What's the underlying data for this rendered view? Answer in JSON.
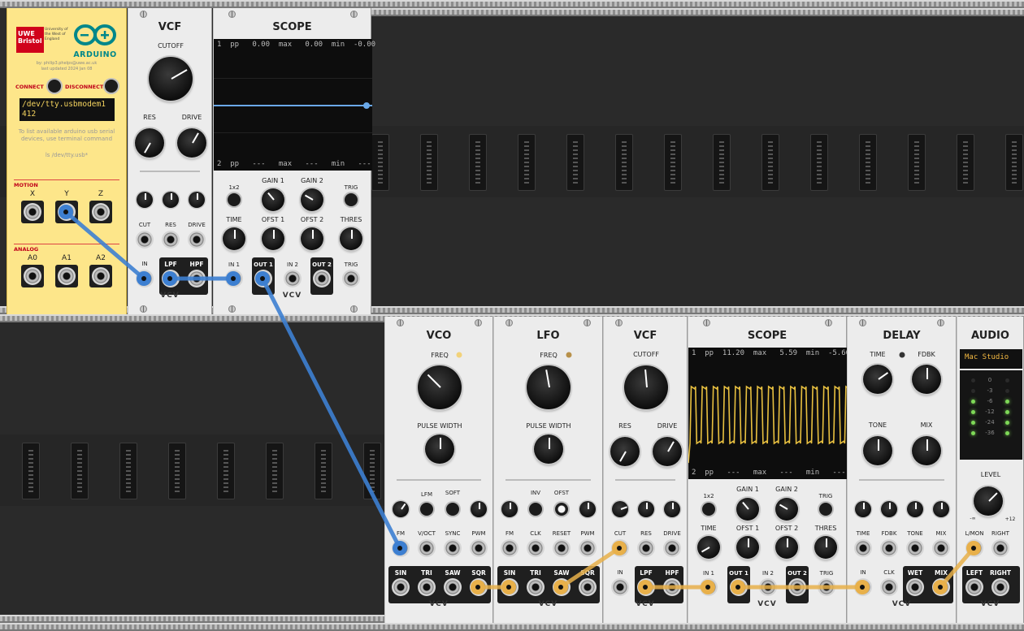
{
  "arduino": {
    "uwe_logo": "UWE Bristol",
    "uwe_sub": "University of the West of England",
    "arduino_logo": "ARDUINO",
    "author": "by: philip3.phelps@uwe.ac.uk",
    "updated": "last updated 2024 Jan 08",
    "connect_label": "CONNECT",
    "disconnect_label": "DISCONNECT",
    "port_line1": "/dev/tty.usbmodem1",
    "port_line2": "412",
    "help_text": "To list available arduino usb serial devices, use terminal command",
    "help_cmd": "ls /dev/tty.usb*",
    "motion_title": "MOTION",
    "motion_labels": [
      "X",
      "Y",
      "Z"
    ],
    "analog_title": "ANALOG",
    "analog_labels": [
      "A0",
      "A1",
      "A2"
    ]
  },
  "vcf_top": {
    "title": "VCF",
    "cutoff": "CUTOFF",
    "res": "RES",
    "drive": "DRIVE",
    "cv_labels": [
      "CUT",
      "RES",
      "DRIVE"
    ],
    "in": "IN",
    "lpf": "LPF",
    "hpf": "HPF",
    "brand": "VCV"
  },
  "scope_top": {
    "title": "SCOPE",
    "line1": "1  pp   0.00  max   0.00  min  -0.00",
    "line2": "2  pp   ---   max   ---   min   ---",
    "labels": {
      "x12": "1x2",
      "gain1": "GAIN 1",
      "gain2": "GAIN 2",
      "trig": "TRIG",
      "time": "TIME",
      "ofst1": "OFST 1",
      "ofst2": "OFST 2",
      "thres": "THRES",
      "in1": "IN 1",
      "out1": "OUT 1",
      "in2": "IN 2",
      "out2": "OUT 2",
      "trig_in": "TRIG"
    },
    "brand": "VCV"
  },
  "vco": {
    "title": "VCO",
    "freq": "FREQ",
    "pulse_width": "PULSE WIDTH",
    "lfm": "LFM",
    "soft": "SOFT",
    "in_labels": [
      "FM",
      "V/OCT",
      "SYNC",
      "PWM"
    ],
    "out_labels": [
      "SIN",
      "TRI",
      "SAW",
      "SQR"
    ],
    "brand": "VCV"
  },
  "lfo": {
    "title": "LFO",
    "freq": "FREQ",
    "pulse_width": "PULSE WIDTH",
    "inv": "INV",
    "ofst": "OFST",
    "in_labels": [
      "FM",
      "CLK",
      "RESET",
      "PWM"
    ],
    "out_labels": [
      "SIN",
      "TRI",
      "SAW",
      "SQR"
    ],
    "brand": "VCV"
  },
  "vcf_bot": {
    "title": "VCF",
    "cutoff": "CUTOFF",
    "res": "RES",
    "drive": "DRIVE",
    "cv_labels": [
      "CUT",
      "RES",
      "DRIVE"
    ],
    "in": "IN",
    "lpf": "LPF",
    "hpf": "HPF",
    "brand": "VCV"
  },
  "scope_bot": {
    "title": "SCOPE",
    "line1": "1  pp  11.20  max   5.59  min  -5.60",
    "line2": "2  pp   ---   max   ---   min   ---",
    "labels": {
      "x12": "1x2",
      "gain1": "GAIN 1",
      "gain2": "GAIN 2",
      "trig": "TRIG",
      "time": "TIME",
      "ofst1": "OFST 1",
      "ofst2": "OFST 2",
      "thres": "THRES",
      "in1": "IN 1",
      "out1": "OUT 1",
      "in2": "IN 2",
      "out2": "OUT 2",
      "trig_in": "TRIG"
    },
    "brand": "VCV"
  },
  "delay": {
    "title": "DELAY",
    "time": "TIME",
    "fdbk": "FDBK",
    "tone": "TONE",
    "mix": "MIX",
    "cv_labels": [
      "TIME",
      "FDBK",
      "TONE",
      "MIX"
    ],
    "in": "IN",
    "clk": "CLK",
    "wet": "WET",
    "mixo": "MIX",
    "brand": "VCV"
  },
  "audio": {
    "title": "AUDIO",
    "device": "Mac Studio",
    "meter_labels": [
      "0",
      "-3",
      "-6",
      "-12",
      "-24",
      "-36"
    ],
    "level": "LEVEL",
    "min_lbl": "-∞",
    "max_lbl": "+12",
    "lmon": "L/MON",
    "right": "RIGHT",
    "left_out": "LEFT",
    "right_out": "RIGHT",
    "brand": "VCV"
  },
  "colors": {
    "blue_cable": "#3d7fd1",
    "yellow_cable": "#e8b04a",
    "arduino_panel": "#fde68a",
    "scope_trace_blue": "#6aa8e8",
    "scope_trace_yellow": "#e8c040"
  }
}
